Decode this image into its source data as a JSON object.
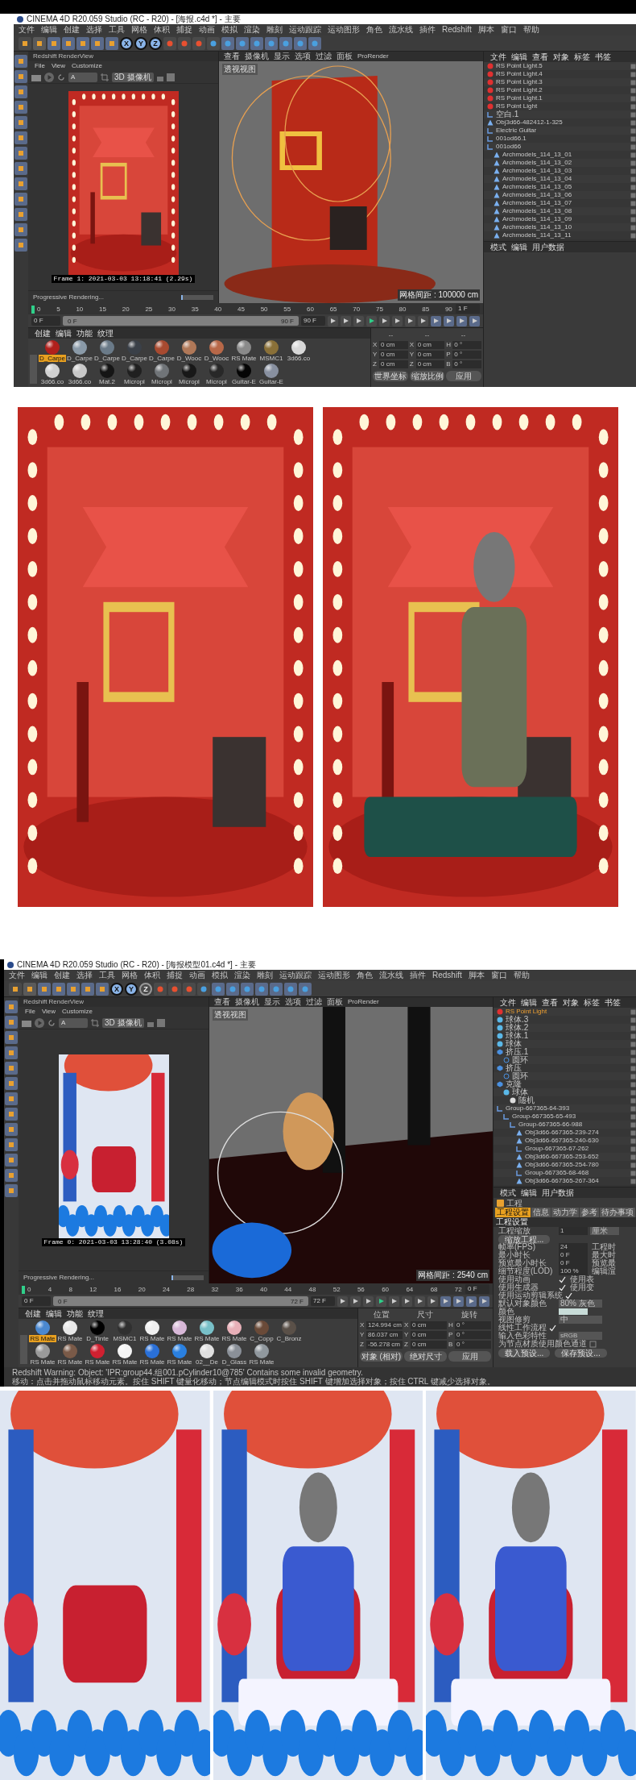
{
  "windows": [
    {
      "title": "CINEMA 4D R20.059 Studio (RC - R20) - [海报.c4d *] - 主要",
      "menu": [
        "文件",
        "编辑",
        "创建",
        "选择",
        "工具",
        "网格",
        "体积",
        "捕捉",
        "动画",
        "模拟",
        "渲染",
        "雕刻",
        "运动跟踪",
        "运动图形",
        "角色",
        "流水线",
        "插件",
        "Redshift",
        "脚本",
        "窗口",
        "帮助"
      ],
      "toolbar_axes": [
        {
          "label": "X",
          "selected": true
        },
        {
          "label": "Y",
          "selected": true
        },
        {
          "label": "Z",
          "selected": true
        }
      ],
      "render_view": {
        "title": "Redshift RenderView",
        "menu": [
          "File",
          "View",
          "Customize"
        ],
        "channel": "A",
        "camera": "3D 摄像机",
        "kind": "stage",
        "frame_info": "Frame 1: 2021-03-03 13:18:41 (2.29s)",
        "status": "Progressive Rendering...",
        "level": 0.05
      },
      "viewport": {
        "menu": [
          "查看",
          "摄像机",
          "显示",
          "选项",
          "过滤",
          "面板",
          "ProRender"
        ],
        "view_name": "透视视图",
        "kind": "stage",
        "grid_spacing": "网格间距 : 100000 cm"
      },
      "timeline": {
        "ticks": [
          "0",
          "5",
          "10",
          "15",
          "20",
          "25",
          "30",
          "35",
          "40",
          "45",
          "50",
          "55",
          "60",
          "65",
          "70",
          "75",
          "80",
          "85",
          "90"
        ],
        "frame": "1 F",
        "current": "0 F",
        "range": {
          "start": "0 F",
          "end": "90 F",
          "level": 1
        },
        "end": "90 F"
      },
      "materials": {
        "tabs": [
          "创建",
          "编辑",
          "功能",
          "纹理"
        ],
        "items": [
          {
            "label": "D_Carpe",
            "selected": true,
            "color": "#b0201c"
          },
          {
            "label": "D_Carpe",
            "selected": false,
            "color": "#8a9aa8"
          },
          {
            "label": "D_Carpe",
            "selected": false,
            "color": "#6a7a88"
          },
          {
            "label": "D_Carpe",
            "selected": false,
            "color": "#3a4048"
          },
          {
            "label": "D_Carpe",
            "selected": false,
            "color": "#a84a30"
          },
          {
            "label": "D_Wooc",
            "selected": false,
            "color": "#b07858"
          },
          {
            "label": "D_Wooc",
            "selected": false,
            "color": "#b86848"
          },
          {
            "label": "RS Mate",
            "selected": false,
            "color": "#8a8a8a"
          },
          {
            "label": "MSMC1",
            "selected": false,
            "color": "#8a7038"
          },
          {
            "label": "3d66.co",
            "selected": false,
            "color": "#d8d8d8"
          },
          {
            "label": "3d66.co",
            "selected": false,
            "color": "#d0d0d0"
          },
          {
            "label": "3d66.co",
            "selected": false,
            "color": "#c8c8c8"
          },
          {
            "label": "Mat.2",
            "selected": false,
            "color": "#151515"
          },
          {
            "label": "Micropl",
            "selected": false,
            "color": "#202020"
          },
          {
            "label": "Micropl",
            "selected": false,
            "color": "#707478"
          },
          {
            "label": "Micropl",
            "selected": false,
            "color": "#181818"
          },
          {
            "label": "Micropl",
            "selected": false,
            "color": "#282828"
          },
          {
            "label": "Guitar-E",
            "selected": false,
            "color": "#050505"
          },
          {
            "label": "Guitar-E",
            "selected": false,
            "color": "#8890a0"
          }
        ]
      },
      "coordinates": {
        "headers": [
          "--",
          "--",
          "--"
        ],
        "rows": [
          {
            "axis": "X",
            "position": "0 cm",
            "size_axis": "X",
            "size": "0 cm",
            "rot_axis": "H",
            "rotation": "0 °"
          },
          {
            "axis": "Y",
            "position": "0 cm",
            "size_axis": "Y",
            "size": "0 cm",
            "rot_axis": "P",
            "rotation": "0 °"
          },
          {
            "axis": "Z",
            "position": "0 cm",
            "size_axis": "Z",
            "size": "0 cm",
            "rot_axis": "B",
            "rotation": "0 °"
          }
        ],
        "mode": "世界坐标",
        "size_mode": "缩放比例",
        "apply": "应用"
      },
      "objects": {
        "tabs": [
          "文件",
          "编辑",
          "查看",
          "对象",
          "标签",
          "书签"
        ],
        "items": [
          {
            "name": "RS Point Light.5",
            "kind": "light",
            "selected": false
          },
          {
            "name": "RS Point Light.4",
            "kind": "light",
            "selected": false
          },
          {
            "name": "RS Point Light.3",
            "kind": "light",
            "selected": false
          },
          {
            "name": "RS Point Light.2",
            "kind": "light",
            "selected": false
          },
          {
            "name": "RS Point Light.1",
            "kind": "light",
            "selected": false
          },
          {
            "name": "RS Point Light",
            "kind": "light",
            "selected": false
          },
          {
            "name": "空白.1",
            "kind": "null",
            "selected": false
          },
          {
            "name": "Obj3d66-482412-1-325",
            "kind": "mesh",
            "selected": false
          },
          {
            "name": "Electric Guitar",
            "kind": "null",
            "selected": false
          },
          {
            "name": "001od66.1",
            "kind": "null",
            "selected": false
          },
          {
            "name": "001od66",
            "kind": "null",
            "selected": false,
            "children": [
              {
                "name": "Archmodels_114_13_01",
                "kind": "mesh",
                "selected": false
              },
              {
                "name": "Archmodels_114_13_02",
                "kind": "mesh",
                "selected": false
              },
              {
                "name": "Archmodels_114_13_03",
                "kind": "mesh",
                "selected": false
              },
              {
                "name": "Archmodels_114_13_04",
                "kind": "mesh",
                "selected": false
              },
              {
                "name": "Archmodels_114_13_05",
                "kind": "mesh",
                "selected": false
              },
              {
                "name": "Archmodels_114_13_06",
                "kind": "mesh",
                "selected": false
              },
              {
                "name": "Archmodels_114_13_07",
                "kind": "mesh",
                "selected": false
              },
              {
                "name": "Archmodels_114_13_08",
                "kind": "mesh",
                "selected": false
              },
              {
                "name": "Archmodels_114_13_09",
                "kind": "mesh",
                "selected": false
              },
              {
                "name": "Archmodels_114_13_10",
                "kind": "mesh",
                "selected": false
              },
              {
                "name": "Archmodels_114_13_11",
                "kind": "mesh",
                "selected": false
              }
            ]
          }
        ]
      },
      "attributes": {
        "tabs": [
          "模式",
          "编辑",
          "用户数据"
        ]
      }
    },
    {
      "title": "CINEMA 4D R20.059 Studio (RC - R20) - [海报模型01.c4d *] - 主要",
      "menu": [
        "文件",
        "编辑",
        "创建",
        "选择",
        "工具",
        "网格",
        "体积",
        "捕捉",
        "动画",
        "模拟",
        "渲染",
        "雕刻",
        "运动跟踪",
        "运动图形",
        "角色",
        "流水线",
        "插件",
        "Redshift",
        "脚本",
        "窗口",
        "帮助"
      ],
      "toolbar_axes": [
        {
          "label": "X",
          "selected": true
        },
        {
          "label": "Y",
          "selected": true
        },
        {
          "label": "Z",
          "selected": false
        }
      ],
      "render_view": {
        "title": "Redshift RenderView",
        "menu": [
          "File",
          "View",
          "Customize"
        ],
        "channel": "A",
        "camera": "3D 摄像机",
        "kind": "playground",
        "frame_info": "Frame 0: 2021-03-03 13:28:40 (3.08s)",
        "status": "Progressive Rendering...",
        "level": 0.05
      },
      "viewport": {
        "menu": [
          "查看",
          "摄像机",
          "显示",
          "选项",
          "过滤",
          "面板",
          "ProRender"
        ],
        "view_name": "透视视图",
        "kind": "playground",
        "grid_spacing": "网格间距 : 2540 cm"
      },
      "timeline": {
        "ticks": [
          "0",
          "4",
          "8",
          "12",
          "16",
          "20",
          "24",
          "28",
          "32",
          "36",
          "40",
          "44",
          "48",
          "52",
          "56",
          "60",
          "64",
          "68",
          "72"
        ],
        "frame": "0 F",
        "current": "0 F",
        "range": {
          "start": "0 F",
          "end": "72 F",
          "level": 1
        },
        "end": "72 F"
      },
      "materials": {
        "tabs": [
          "创建",
          "编辑",
          "功能",
          "纹理"
        ],
        "items": [
          {
            "label": "RS Mate",
            "selected": true,
            "color": "#4a88d0"
          },
          {
            "label": "RS Mate",
            "selected": false,
            "color": "#e8e8e8"
          },
          {
            "label": "D_Tinte",
            "selected": false,
            "color": "#000000"
          },
          {
            "label": "MSMC1",
            "selected": false,
            "color": "#303030"
          },
          {
            "label": "RS Mate",
            "selected": false,
            "color": "#f0f0f0"
          },
          {
            "label": "RS Mate",
            "selected": false,
            "color": "#d8b8d8"
          },
          {
            "label": "RS Mate",
            "selected": false,
            "color": "#78c0c8"
          },
          {
            "label": "RS Mate",
            "selected": false,
            "color": "#e8b0b8"
          },
          {
            "label": "C_Copp",
            "selected": false,
            "color": "#6a4a38"
          },
          {
            "label": "C_Bronz",
            "selected": false,
            "color": "#5a5048"
          },
          {
            "label": "RS Mate",
            "selected": false,
            "color": "#9a9a9a"
          },
          {
            "label": "RS Mate",
            "selected": false,
            "color": "#7a5a48"
          },
          {
            "label": "RS Mate",
            "selected": false,
            "color": "#d02030"
          },
          {
            "label": "RS Mate",
            "selected": false,
            "color": "#f4f4f4"
          },
          {
            "label": "RS Mate",
            "selected": false,
            "color": "#2a70d8"
          },
          {
            "label": "RS Mate",
            "selected": false,
            "color": "#2a80e0"
          },
          {
            "label": "02__De",
            "selected": false,
            "color": "#e0e0e0"
          },
          {
            "label": "D_Glass",
            "selected": false,
            "color": "#8a9098"
          },
          {
            "label": "RS Mate",
            "selected": false,
            "color": "#90989e"
          }
        ]
      },
      "coordinates": {
        "headers": [
          "位置",
          "尺寸",
          "旋转"
        ],
        "rows": [
          {
            "axis": "X",
            "position": "124.994 cm",
            "size_axis": "X",
            "size": "0 cm",
            "rot_axis": "H",
            "rotation": "0 °"
          },
          {
            "axis": "Y",
            "position": "86.037 cm",
            "size_axis": "Y",
            "size": "0 cm",
            "rot_axis": "P",
            "rotation": "0 °"
          },
          {
            "axis": "Z",
            "position": "-56.278 cm",
            "size_axis": "Z",
            "size": "0 cm",
            "rot_axis": "B",
            "rotation": "0 °"
          }
        ],
        "mode": "对象 (相对)",
        "size_mode": "绝对尺寸",
        "apply": "应用"
      },
      "objects": {
        "tabs": [
          "文件",
          "编辑",
          "查看",
          "对象",
          "标签",
          "书签"
        ],
        "items": [
          {
            "name": "RS Point Light",
            "kind": "light",
            "selected": true
          },
          {
            "name": "球体.3",
            "kind": "sphere",
            "selected": false
          },
          {
            "name": "球体.2",
            "kind": "sphere",
            "selected": false
          },
          {
            "name": "球体.1",
            "kind": "sphere",
            "selected": false
          },
          {
            "name": "球体",
            "kind": "sphere",
            "selected": false
          },
          {
            "name": "挤压.1",
            "kind": "generator",
            "selected": false,
            "children": [
              {
                "name": "圆环",
                "kind": "spline",
                "selected": false
              }
            ]
          },
          {
            "name": "挤压",
            "kind": "generator",
            "selected": false,
            "children": [
              {
                "name": "圆环",
                "kind": "spline",
                "selected": false
              }
            ]
          },
          {
            "name": "克隆",
            "kind": "generator",
            "selected": false,
            "children": [
              {
                "name": "球体",
                "kind": "sphere",
                "selected": false,
                "children": [
                  {
                    "name": "随机",
                    "kind": "effector",
                    "selected": false
                  }
                ]
              }
            ]
          },
          {
            "name": "Group-667365-64-393",
            "kind": "null",
            "selected": false,
            "children": [
              {
                "name": "Group-667365-65-493",
                "kind": "null",
                "selected": false,
                "children": [
                  {
                    "name": "Group-667365-66-988",
                    "kind": "null",
                    "selected": false,
                    "children": [
                      {
                        "name": "Obj3d66-667365-239-274",
                        "kind": "mesh",
                        "selected": false
                      },
                      {
                        "name": "Obj3d66-667365-240-630",
                        "kind": "mesh",
                        "selected": false
                      },
                      {
                        "name": "Group-667365-67-262",
                        "kind": "null",
                        "selected": false
                      },
                      {
                        "name": "Obj3d66-667365-253-652",
                        "kind": "mesh",
                        "selected": false
                      },
                      {
                        "name": "Obj3d66-667365-254-780",
                        "kind": "mesh",
                        "selected": false
                      },
                      {
                        "name": "Group-667365-68-468",
                        "kind": "null",
                        "selected": false
                      },
                      {
                        "name": "Obj3d66-667365-267-364",
                        "kind": "mesh",
                        "selected": false
                      }
                    ]
                  }
                ]
              }
            ]
          }
        ]
      },
      "attributes": {
        "tabs": [
          "模式",
          "编辑",
          "用户数据"
        ],
        "project": {
          "header": "工程",
          "tabs": [
            {
              "label": "工程设置",
              "selected": true
            },
            {
              "label": "信息",
              "selected": false
            },
            {
              "label": "动力学",
              "selected": false
            },
            {
              "label": "参考",
              "selected": false
            },
            {
              "label": "待办事项",
              "selected": false
            }
          ],
          "section": "工程设置",
          "rows": [
            {
              "kind": "field",
              "label": "工程缩放",
              "value": "1",
              "unit": "厘米"
            },
            {
              "kind": "button",
              "label": "缩放工程..."
            },
            {
              "kind": "field",
              "label": "帧率(FPS)",
              "value": "24",
              "side": "工程时"
            },
            {
              "kind": "field",
              "label": "最小时长",
              "value": "0 F",
              "side": "最大时"
            },
            {
              "kind": "field",
              "label": "预览最小时长",
              "value": "0 F",
              "side": "预览最"
            },
            {
              "kind": "field",
              "label": "细节程度(LOD)",
              "value": "100 %",
              "side": "编辑渲"
            },
            {
              "kind": "check",
              "label": "使用动画",
              "checked": true,
              "side": "使用表"
            },
            {
              "kind": "check",
              "label": "使用生成器",
              "checked": true,
              "side": "使用变"
            },
            {
              "kind": "check",
              "label": "使用运动剪辑系统",
              "checked": true
            },
            {
              "kind": "select",
              "label": "默认对象颜色",
              "value": "80% 灰色"
            },
            {
              "kind": "color",
              "label": "颜色",
              "color": "#c8dcd8"
            },
            {
              "kind": "select",
              "label": "视图修剪",
              "value": "中"
            },
            {
              "kind": "check",
              "label": "线性工作流程",
              "checked": true
            },
            {
              "kind": "select",
              "label": "输入色彩特性",
              "value": "sRGB"
            },
            {
              "kind": "check",
              "label": "为节点材质使用颜色通道",
              "checked": false
            }
          ],
          "buttons": [
            "载入预设...",
            "保存预设..."
          ]
        }
      },
      "status_bar": [
        "Redshift Warning: Object: 'IPR:group44.组001.pCylinder10@785' Contains some invalid geometry.",
        "移动：点击并拖动鼠标移动元素。按住 SHIFT 键量化移动；节点编辑模式时按住 SHIFT 键增加选择对象；按住 CTRL 键减少选择对象。"
      ]
    }
  ],
  "showcases": [
    {
      "images": [
        {
          "kind": "stage_scene"
        },
        {
          "kind": "stage_poster"
        }
      ]
    },
    {
      "images": [
        {
          "kind": "playground_scene"
        },
        {
          "kind": "playground_poster"
        },
        {
          "kind": "playground_poster"
        }
      ]
    }
  ]
}
